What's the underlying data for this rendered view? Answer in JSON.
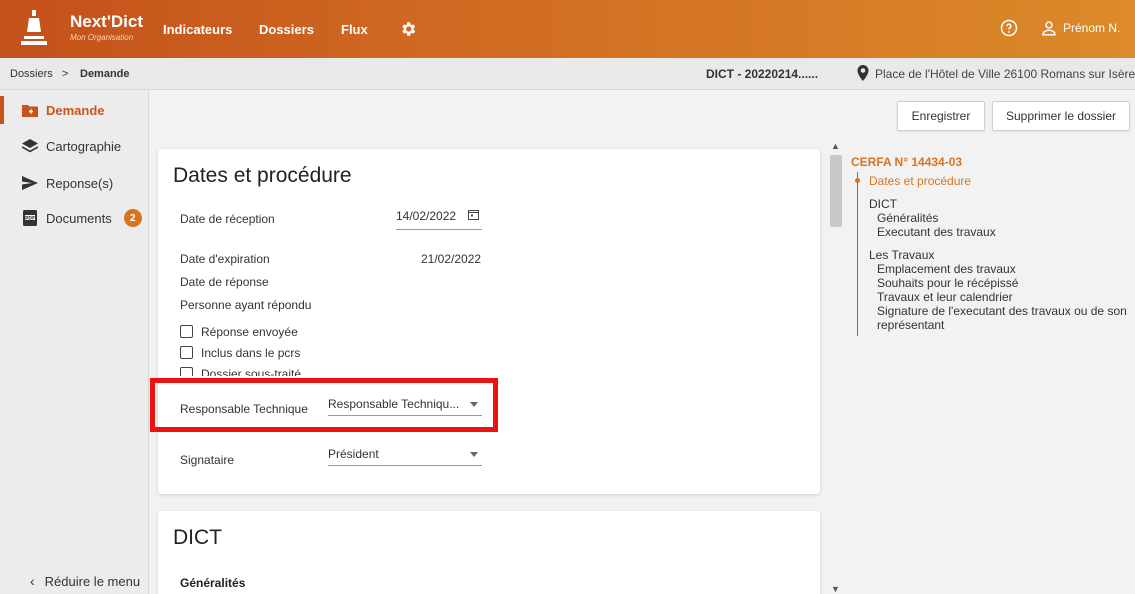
{
  "header": {
    "brand": "Next'Dict",
    "organization": "Mon Organisation",
    "nav": [
      "Indicateurs",
      "Dossiers",
      "Flux"
    ],
    "user": "Prénom N.",
    "colors": {
      "primary": "#c9541b",
      "accent": "#d9731e"
    }
  },
  "breadcrumb": {
    "root": "Dossiers",
    "separator": ">",
    "current": "Demande",
    "dict_id": "DICT - 20220214......",
    "address": "Place de l'Hôtel de Ville 26100 Romans sur Isère"
  },
  "sidebar": {
    "items": [
      {
        "label": "Demande",
        "icon": "folder-plus-icon",
        "active": true
      },
      {
        "label": "Cartographie",
        "icon": "layers-icon"
      },
      {
        "label": "Reponse(s)",
        "icon": "send-icon"
      },
      {
        "label": "Documents",
        "icon": "pdf-icon",
        "badge": "2"
      }
    ],
    "reduce_label": "Réduire le menu"
  },
  "actions": {
    "save": "Enregistrer",
    "delete": "Supprimer le dossier"
  },
  "form": {
    "title": "Dates et procédure",
    "reception_label": "Date de réception",
    "reception_value": "14/02/2022",
    "expiration_label": "Date d'expiration",
    "expiration_value": "21/02/2022",
    "response_label": "Date de réponse",
    "person_label": "Personne ayant répondu",
    "checkboxes": [
      "Réponse envoyée",
      "Inclus dans le pcrs",
      "Dossier sous-traité"
    ],
    "tech_label": "Responsable Technique",
    "tech_value": "Responsable Techniqu...",
    "signataire_label": "Signataire",
    "signataire_value": "Président"
  },
  "section2": {
    "title": "DICT",
    "subtitle": "Généralités"
  },
  "toc": {
    "heading": "CERFA N° 14434-03",
    "active": "Dates et procédure",
    "group1": "DICT",
    "group1_items": [
      "Généralités",
      "Executant des travaux"
    ],
    "group2": "Les Travaux",
    "group2_items": [
      "Emplacement des travaux",
      "Souhaits pour le récépissé",
      "Travaux et leur calendrier",
      "Signature de l'executant des travaux ou de son",
      "représentant"
    ]
  }
}
